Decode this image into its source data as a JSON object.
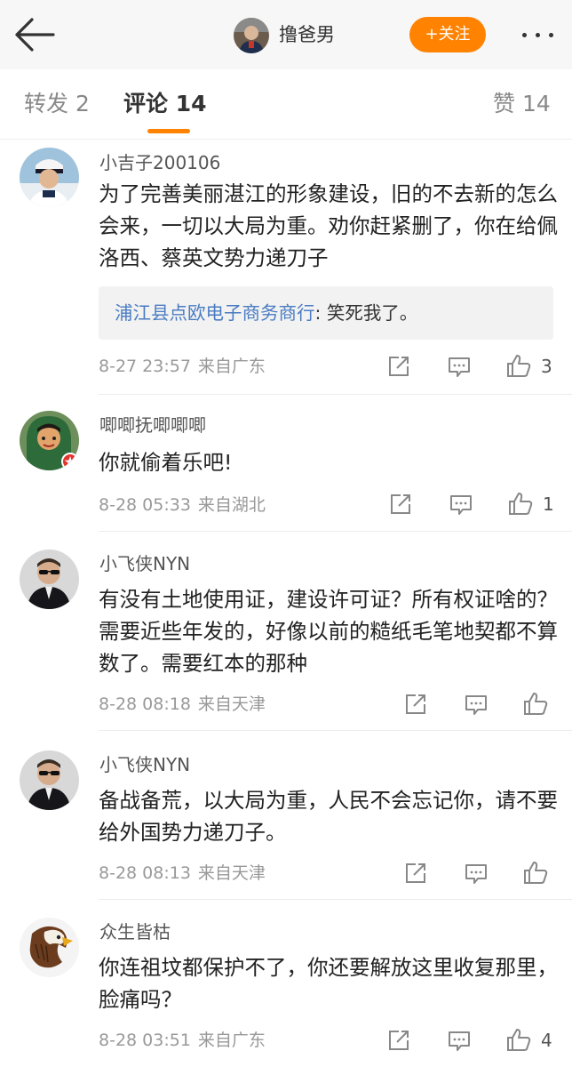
{
  "header": {
    "user_name": "撸爸男",
    "follow_label": "+关注"
  },
  "tabs": [
    {
      "label": "转发 2"
    },
    {
      "label": "评论 14"
    },
    {
      "label": "赞 14"
    }
  ],
  "comments": [
    {
      "user": "小吉子200106",
      "text": "为了完善美丽湛江的形象建设，旧的不去新的怎么会来，一切以大局为重。劝你赶紧删了，你在给佩洛西、蔡英文势力递刀子",
      "reply_user": "浦江县点欧电子商务商行",
      "reply_text": ": 笑死我了。",
      "time": "8-27 23:57",
      "source": "来自广东",
      "likes": "3"
    },
    {
      "user": "唧唧抚唧唧唧",
      "text": "你就偷着乐吧!",
      "time": "8-28 05:33",
      "source": "来自湖北",
      "likes": "1"
    },
    {
      "user": "小飞侠NYN",
      "text": "有没有土地使用证，建设许可证？所有权证啥的？需要近些年发的，好像以前的糙纸毛笔地契都不算数了。需要红本的那种",
      "time": "8-28 08:18",
      "source": "来自天津",
      "likes": ""
    },
    {
      "user": "小飞侠NYN",
      "text": "备战备荒，以大局为重，人民不会忘记你，请不要给外国势力递刀子。",
      "time": "8-28 08:13",
      "source": "来自天津",
      "likes": ""
    },
    {
      "user": "众生皆枯",
      "text": "你连祖坟都保护不了，你还要解放这里收复那里，脸痛吗？",
      "time": "8-28 03:51",
      "source": "来自广东",
      "likes": "4"
    }
  ],
  "colors": {
    "accent": "#ff8200",
    "link": "#4a7cc2"
  }
}
